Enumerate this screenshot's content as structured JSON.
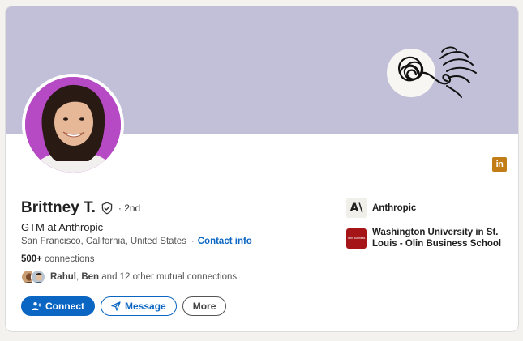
{
  "profile": {
    "name": "Brittney T.",
    "degree": "· 2nd",
    "headline": "GTM at Anthropic",
    "location": "San Francisco, California, United States",
    "contact_sep": "·",
    "contact_label": "Contact info",
    "connections_count": "500+",
    "connections_label": "connections",
    "mutual_name_1": "Rahul",
    "mutual_sep": ", ",
    "mutual_name_2": "Ben",
    "mutual_rest": " and 12 other mutual connections"
  },
  "actions": {
    "connect_label": "Connect",
    "message_label": "Message",
    "more_label": "More"
  },
  "orgs": {
    "current": {
      "name": "Anthropic",
      "logo_text": "A\\"
    },
    "education": {
      "name": "Washington University in St. Louis - Olin Business School",
      "logo_text": "Olin Business"
    }
  },
  "badges": {
    "linkedin_text": "in"
  },
  "colors": {
    "banner": "#c2c0d8",
    "primary": "#0a66c2",
    "avatar_bg": "#b64ac5",
    "linkedin_badge": "#c37d16",
    "olin_red": "#a51417"
  }
}
